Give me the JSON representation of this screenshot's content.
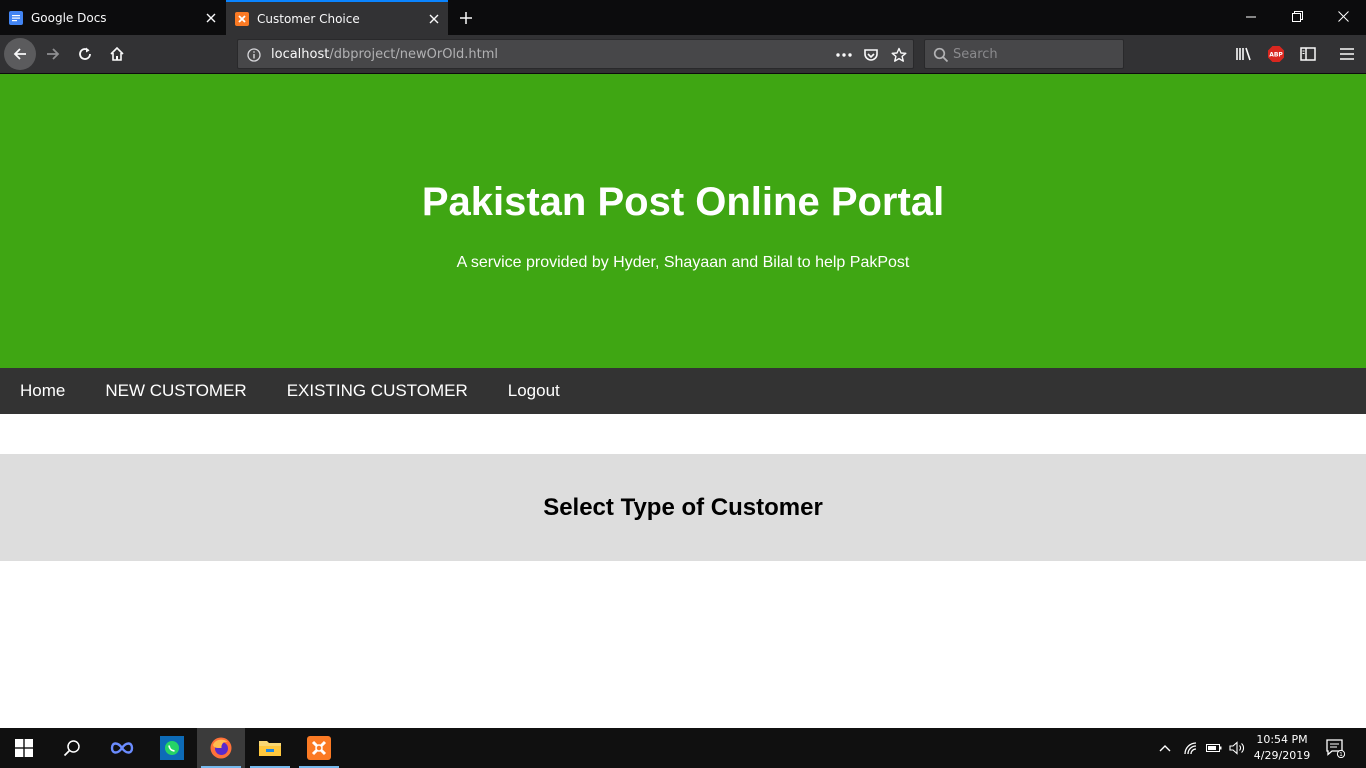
{
  "browser": {
    "tabs": [
      {
        "title": "Google Docs",
        "favicon": "google-docs-icon",
        "active": false
      },
      {
        "title": "Customer Choice",
        "favicon": "xampp-icon",
        "active": true
      }
    ],
    "url": {
      "host": "localhost",
      "path": "/dbproject/newOrOld.html"
    },
    "search": {
      "placeholder": "Search"
    },
    "accent": "#0a84ff"
  },
  "page": {
    "header": {
      "title": "Pakistan Post Online Portal",
      "subtitle": "A service provided by Hyder, Shayaan and Bilal to help PakPost",
      "bg_color": "#3fa613"
    },
    "nav": {
      "items": [
        "Home",
        "NEW CUSTOMER",
        "EXISTING CUSTOMER",
        "Logout"
      ],
      "bg_color": "#333333"
    },
    "section": {
      "heading": "Select Type of Customer",
      "bg_color": "#dddddd"
    }
  },
  "taskbar": {
    "apps": [
      "windows-start-icon",
      "search-icon",
      "infinity-app-icon",
      "whatsapp-icon",
      "firefox-icon",
      "file-explorer-icon",
      "xampp-icon"
    ],
    "clock": {
      "time": "10:54 PM",
      "date": "4/29/2019"
    },
    "notification_count": "1"
  }
}
